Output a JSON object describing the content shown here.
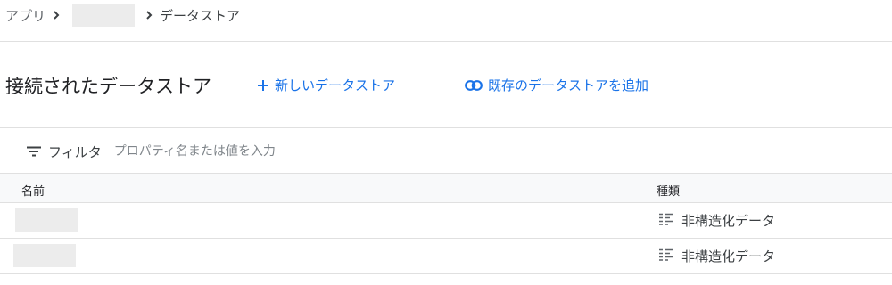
{
  "breadcrumb": {
    "app": "アプリ",
    "current": "データストア"
  },
  "header": {
    "title": "接続されたデータストア",
    "new_datastore": "新しいデータストア",
    "add_existing": "既存のデータストアを追加"
  },
  "filter": {
    "label": "フィルタ",
    "placeholder": "プロパティ名または値を入力"
  },
  "table": {
    "columns": {
      "name": "名前",
      "type": "種類"
    },
    "rows": [
      {
        "type": "非構造化データ"
      },
      {
        "type": "非構造化データ"
      }
    ]
  },
  "colors": {
    "accent": "#1a73e8",
    "redaction": "#ececec"
  },
  "icons": {
    "separator": "chevron-right-icon",
    "new": "plus-icon",
    "add_existing": "link-icon",
    "filter": "filter-icon",
    "row_type": "unstructured-data-icon"
  }
}
